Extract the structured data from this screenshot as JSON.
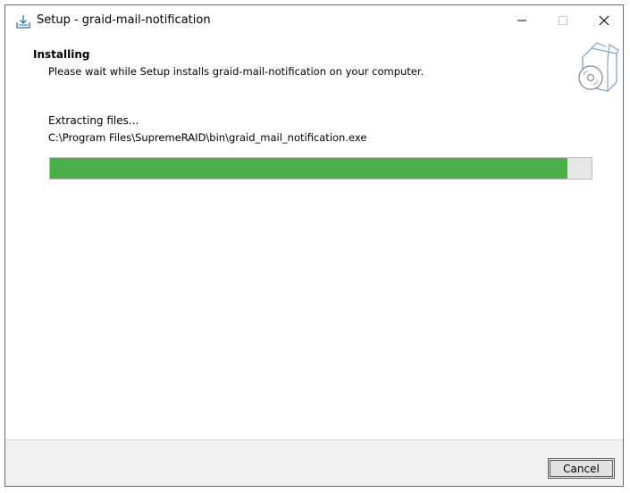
{
  "window": {
    "title": "Setup - graid-mail-notification"
  },
  "header": {
    "title": "Installing",
    "subtitle": "Please wait while Setup installs graid-mail-notification on your computer."
  },
  "main": {
    "status_text": "Extracting files...",
    "current_file": "C:\\Program Files\\SupremeRAID\\bin\\graid_mail_notification.exe",
    "progress_fraction": 0.955
  },
  "footer": {
    "cancel_label": "Cancel"
  },
  "colors": {
    "progress_fill": "#4caf47",
    "progress_track": "#e6e6e6",
    "button_border": "#0078d7",
    "footer_bg": "#f0f0f0"
  },
  "icons": {
    "app": "setup-download-icon",
    "header": "software-box-cd-icon",
    "minimize": "minimize-icon",
    "maximize": "maximize-icon",
    "close": "close-icon"
  }
}
